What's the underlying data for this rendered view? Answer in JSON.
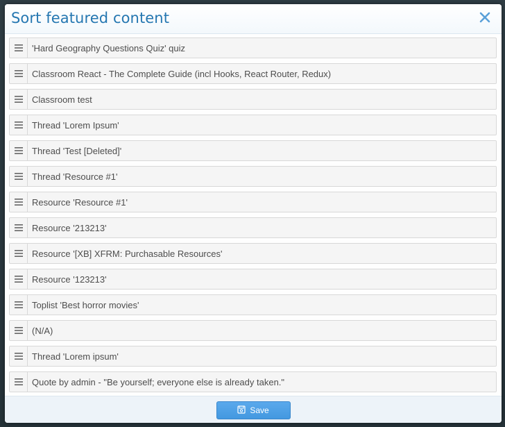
{
  "dialog": {
    "title": "Sort featured content",
    "close_icon": "close-icon",
    "accent_color": "#2577b1"
  },
  "items": [
    {
      "label": "'Hard Geography Questions Quiz' quiz"
    },
    {
      "label": "Classroom React - The Complete Guide (incl Hooks, React Router, Redux)"
    },
    {
      "label": "Classroom test"
    },
    {
      "label": "Thread 'Lorem Ipsum'"
    },
    {
      "label": "Thread 'Test [Deleted]'"
    },
    {
      "label": "Thread 'Resource #1'"
    },
    {
      "label": "Resource 'Resource #1'"
    },
    {
      "label": "Resource '213213'"
    },
    {
      "label": "Resource '[XB] XFRM: Purchasable Resources'"
    },
    {
      "label": "Resource '123213'"
    },
    {
      "label": "Toplist 'Best horror movies'"
    },
    {
      "label": "(N/A)"
    },
    {
      "label": "Thread 'Lorem ipsum'"
    },
    {
      "label": "Quote by admin - \"Be yourself; everyone else is already taken.\""
    }
  ],
  "footer": {
    "save_label": "Save",
    "save_icon": "save-icon",
    "button_color": "#4a9fe6"
  }
}
